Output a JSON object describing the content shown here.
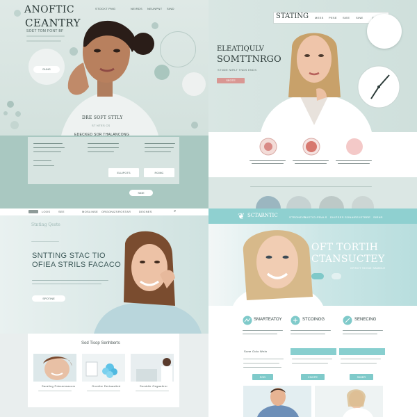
{
  "q1": {
    "title_line1": "ANOFTIC",
    "title_line2": "CEANTRY",
    "subtitle": "SOET TOM FONT BF",
    "nav": [
      "STOCKT PMG",
      "NEIRDS",
      "NEUNPNT",
      "SIND"
    ],
    "cta": "DUNS",
    "mid_heading": "DRE SOFT STTLY",
    "mid_sub": "ST NTES CS",
    "section_heading": "EDECKED SOR THALANCONG",
    "buttons": [
      "ELLIPOTS",
      "ROINC"
    ],
    "bottom_button": "SIDE"
  },
  "q2": {
    "nav_brand": "STATING",
    "nav_items": [
      "MEES",
      "PESE",
      "SIEE",
      "SINE",
      "ONSSELAORE"
    ],
    "hero_line1": "ELEATIQULV",
    "hero_line2": "SOMTTNRGO",
    "hero_tag": "STNDE NIRLT TNDS ENDS",
    "cta": "SEOTE"
  },
  "q3": {
    "nav": [
      "LOOS",
      "SEE",
      "MOSLINSE",
      "ORGONIZS",
      "ROSTAR",
      "DEGNES"
    ],
    "overline": "Stnting Qeste",
    "headline_line1": "SNTTING STAC TIO",
    "headline_line2": "OFIEA STRILS FACACO",
    "cta": "SPOTINE",
    "section_title": "Sod Tisop Senhberts",
    "cards": [
      "Saraling Pdnsemsacom",
      "Oronihe Dertaasited",
      "Sonddle Oegaatirer"
    ]
  },
  "q4": {
    "brand": "SCTARNTIC",
    "nav": [
      "STRONEYS",
      "DUSTICL",
      "PRALS",
      "DHIPSES",
      "SONAIRS",
      "ISTBRE",
      "SIRNS"
    ],
    "hero_line1": "OFT TORTIH",
    "hero_line2": "CTANSUCTEY",
    "hero_tag": "ORSOT SIONZ SAMDLE",
    "features": [
      "SMARTEATOY",
      "STCOINGG",
      "SENECING"
    ],
    "small_header": "Sone Oolo Wnln",
    "buttons": [
      "SOD",
      "CNOPE",
      "SIMER"
    ]
  },
  "colors": {
    "accent_teal": "#88cfcf",
    "mint": "#a9c8c1",
    "coral": "#d98a86"
  }
}
